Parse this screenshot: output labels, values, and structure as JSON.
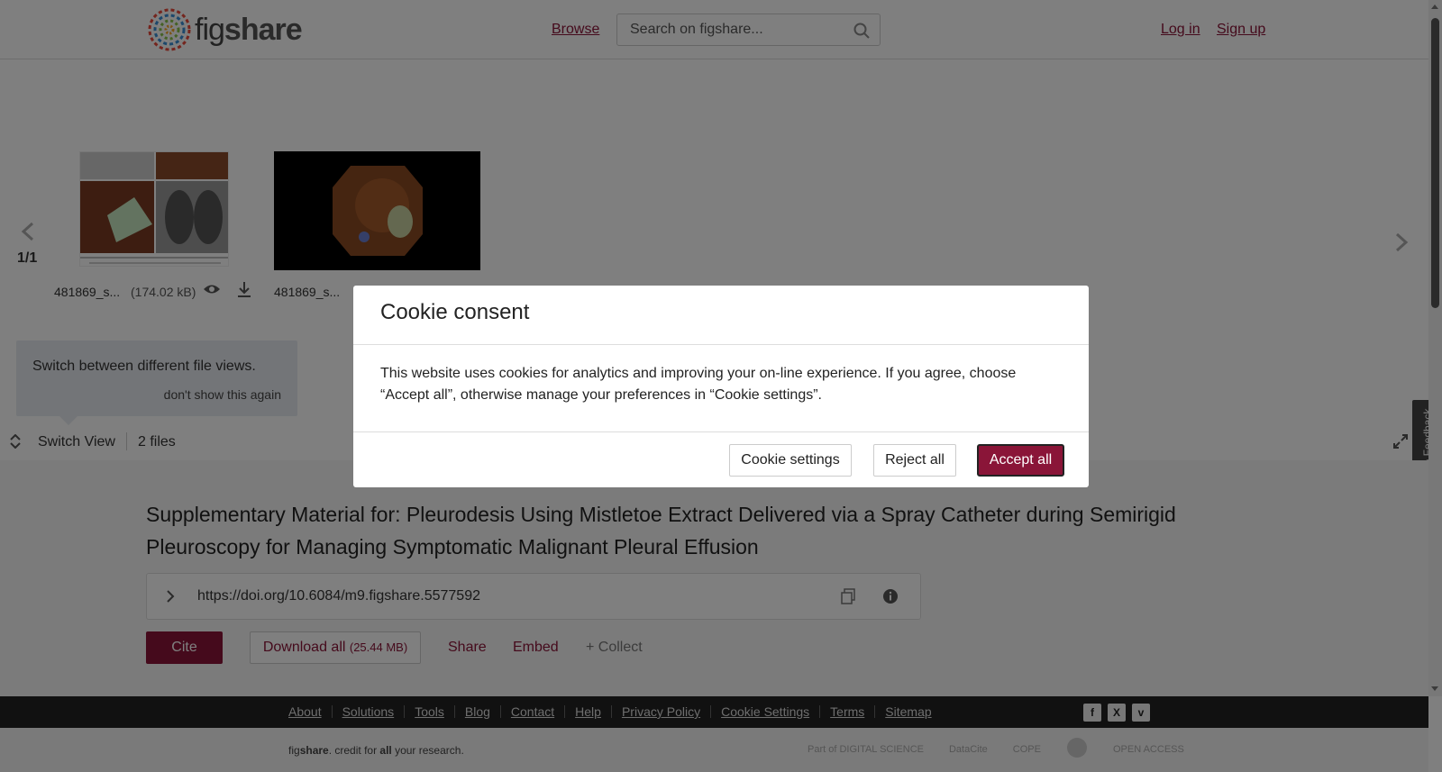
{
  "header": {
    "logo": {
      "text_light": "fig",
      "text_bold": "share"
    },
    "browse_label": "Browse",
    "search_placeholder": "Search on figshare...",
    "login_label": "Log in",
    "signup_label": "Sign up"
  },
  "viewer": {
    "page_count": "1/1",
    "files": [
      {
        "name": "481869_s...",
        "size": "(174.02 kB)"
      },
      {
        "name": "481869_s..."
      }
    ],
    "tooltip": {
      "text": "Switch between different file views.",
      "dismiss": "don't show this again"
    },
    "switch_view_label": "Switch View",
    "files_count": "2 files",
    "feedback_label": "Give Feedback"
  },
  "article": {
    "title": "Supplementary Material for: Pleurodesis Using Mistletoe Extract Delivered via a Spray Catheter during Semirigid Pleuroscopy for Managing Symptomatic Malignant Pleural Effusion",
    "doi": "https://doi.org/10.6084/m9.figshare.5577592",
    "cite_label": "Cite",
    "download_label": "Download all",
    "download_size": "(25.44 MB)",
    "share_label": "Share",
    "embed_label": "Embed",
    "collect_label": "+ Collect"
  },
  "footer": {
    "links": [
      "About",
      "Solutions",
      "Tools",
      "Blog",
      "Contact",
      "Help",
      "Privacy Policy",
      "Cookie Settings",
      "Terms",
      "Sitemap"
    ],
    "social": [
      "f",
      "X",
      "v"
    ],
    "tagline_prefix": "fig",
    "tagline_bold": "share",
    "tagline_mid": ". credit for ",
    "tagline_all": "all",
    "tagline_end": " your research.",
    "partners": [
      "Part of DIGITAL SCIENCE",
      "DataCite",
      "COPE",
      "",
      "OPEN ACCESS"
    ]
  },
  "cookie_modal": {
    "title": "Cookie consent",
    "body": "This website uses cookies for analytics and improving your on-line experience. If you agree, choose “Accept all”, otherwise manage your preferences in “Cookie settings”.",
    "settings_label": "Cookie settings",
    "reject_label": "Reject all",
    "accept_label": "Accept all"
  },
  "colors": {
    "brand": "#8a1538",
    "footer_bg": "#222222",
    "overlay": "rgba(0,0,0,0.5)"
  }
}
